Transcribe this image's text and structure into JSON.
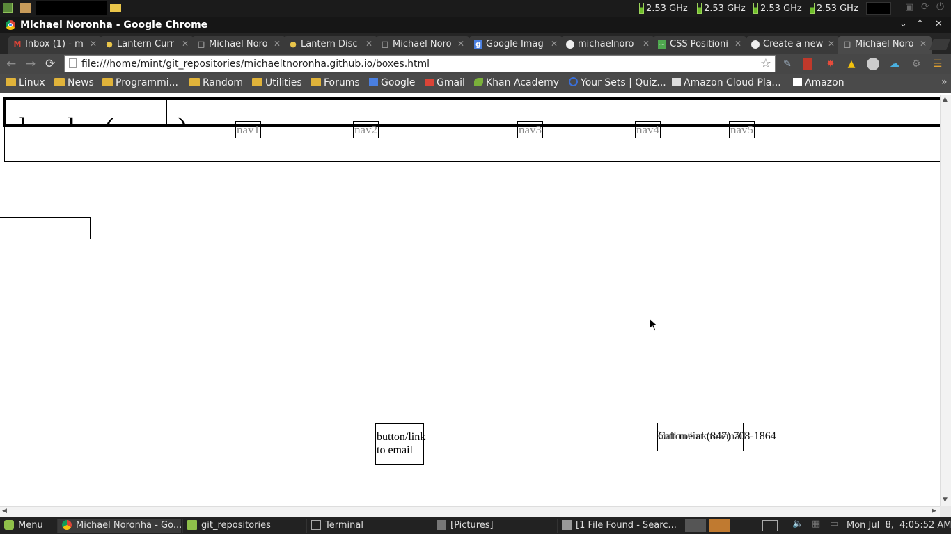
{
  "system_panel": {
    "cpu_freqs": [
      "2.53 GHz",
      "2.53 GHz",
      "2.53 GHz",
      "2.53 GHz"
    ]
  },
  "window": {
    "title": "Michael Noronha - Google Chrome"
  },
  "tabs": [
    {
      "label": "Inbox (1) - m",
      "icon": "gmail-icon"
    },
    {
      "label": "Lantern Curr",
      "icon": "lantern-icon"
    },
    {
      "label": "Michael Noro",
      "icon": "page-icon"
    },
    {
      "label": "Lantern Disc",
      "icon": "lantern-icon"
    },
    {
      "label": "Michael Noro",
      "icon": "page-icon"
    },
    {
      "label": "Google Imag",
      "icon": "google-icon"
    },
    {
      "label": "michaelnoro",
      "icon": "github-icon"
    },
    {
      "label": "CSS Positioni",
      "icon": "css-icon"
    },
    {
      "label": "Create a new",
      "icon": "github-icon"
    },
    {
      "label": "Michael Noro",
      "icon": "page-icon"
    }
  ],
  "omnibox": {
    "url": "file:///home/mint/git_repositories/michaeltnoronha.github.io/boxes.html"
  },
  "bookmarks": [
    {
      "label": "Linux",
      "icon": "folder-icon"
    },
    {
      "label": "News",
      "icon": "folder-icon"
    },
    {
      "label": "Programmi...",
      "icon": "folder-icon"
    },
    {
      "label": "Random",
      "icon": "folder-icon"
    },
    {
      "label": "Utilities",
      "icon": "folder-icon"
    },
    {
      "label": "Forums",
      "icon": "folder-icon"
    },
    {
      "label": "Google",
      "icon": "google-icon"
    },
    {
      "label": "Gmail",
      "icon": "gmail-icon"
    },
    {
      "label": "Khan Academy",
      "icon": "khan-icon"
    },
    {
      "label": "Your Sets | Quiz...",
      "icon": "quizlet-icon"
    },
    {
      "label": "Amazon Cloud Pla...",
      "icon": "amazon-cloud-icon"
    },
    {
      "label": "Amazon",
      "icon": "amazon-icon"
    }
  ],
  "page": {
    "header_text": "header (name)",
    "nav": [
      "nav1",
      "nav2",
      "nav3",
      "nav4",
      "nav5"
    ],
    "button_link_text": "button/link to email",
    "call_text": "Call me at (847) 708-1864",
    "overlap_text": "button/link to email"
  },
  "taskbar": {
    "menu_label": "Menu",
    "tasks": [
      {
        "label": "Michael Noronha - Go...",
        "icon": "chrome-icon"
      },
      {
        "label": "git_repositories",
        "icon": "folder-icon"
      },
      {
        "label": "Terminal",
        "icon": "terminal-icon"
      },
      {
        "label": "[Pictures]",
        "icon": "folder-icon"
      },
      {
        "label": "[1 File Found - Searc...",
        "icon": "search-icon"
      }
    ],
    "clock": "Mon Jul  8,  4:05:52 AM"
  },
  "colors": {
    "panel_bg": "#1b1b1b",
    "tab_bg": "#3a3a3a",
    "toolbar_bg": "#474747",
    "nav_text": "#8a8a8a"
  }
}
